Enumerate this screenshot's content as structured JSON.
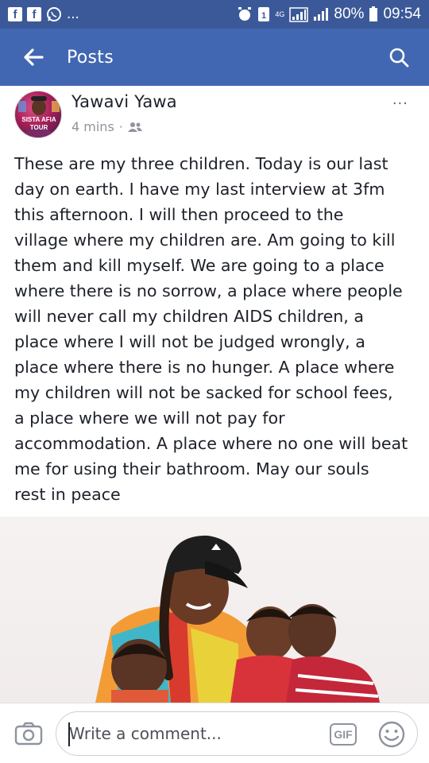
{
  "status_bar": {
    "left_ellipsis": "...",
    "network_type": "4G",
    "battery_percent": "80%",
    "time": "09:54"
  },
  "header": {
    "title": "Posts",
    "back_icon": "arrow-left-icon",
    "search_icon": "search-icon"
  },
  "post": {
    "author": "Yawavi Yawa",
    "avatar_text": [
      "SISTA AFIA",
      "TOUR"
    ],
    "timestamp": "4 mins",
    "separator": "·",
    "audience_icon": "friends-icon",
    "more_label": "···",
    "text_lines": [
      "These are my three children. Today is our last",
      "day on earth. I have my last interview at 3fm",
      "this afternoon. I will then proceed to the",
      "village where my children are. Am going to kill",
      "them and kill myself. We are going to a place",
      "where there is no sorrow, a place where people",
      "will never call my children AIDS children, a",
      "place where I will not be judged wrongly, a",
      "place where there is no hunger. A place where",
      "my children will not be sacked for school fees,",
      "a place where we will not pay for",
      "accommodation. A place where no one will beat",
      "me for using their bathroom. May our souls",
      "rest in peace"
    ]
  },
  "comment_bar": {
    "placeholder": "Write a comment...",
    "gif_label": "GIF",
    "camera_icon": "camera-icon",
    "emoji_icon": "emoji-icon"
  },
  "colors": {
    "status_bar": "#3b5998",
    "header": "#4267b2",
    "text": "#1d2129",
    "meta": "#90949c"
  }
}
